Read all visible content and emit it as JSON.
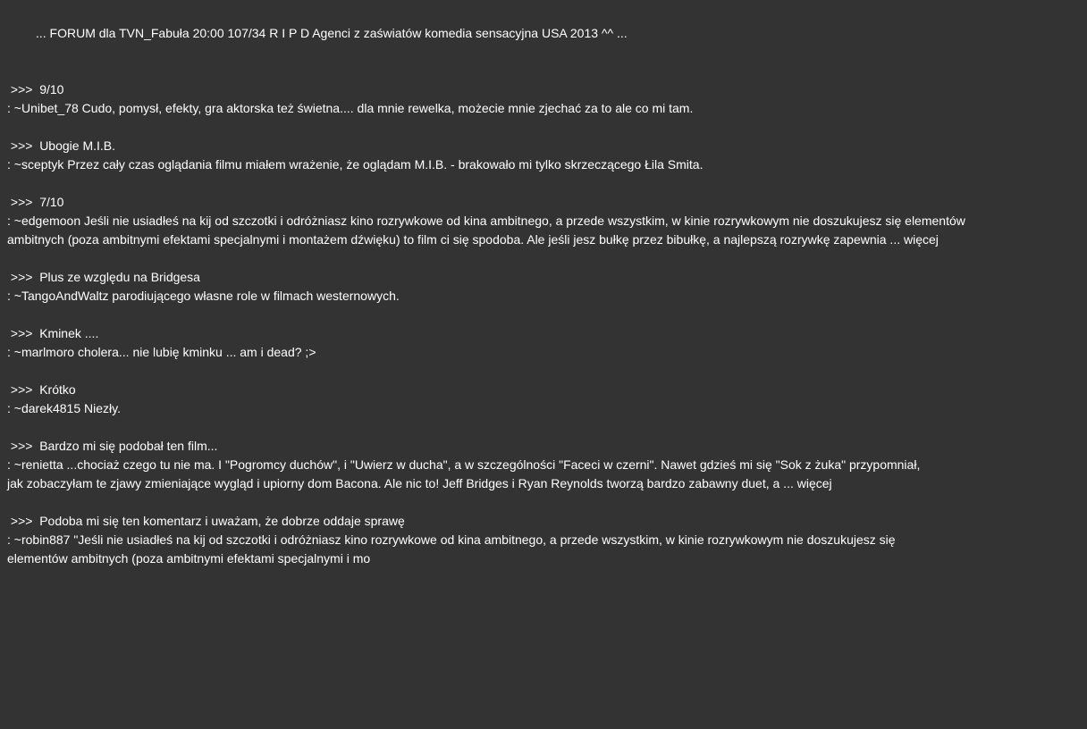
{
  "header": {
    "text": "... FORUM dla TVN_Fabuła 20:00 107/34 R I P D Agenci z zaświatów komedia sensacyjna USA 2013 ^^ ..."
  },
  "posts": [
    {
      "title": " >>>  9/10",
      "lines": [
        ": ~Unibet_78 Cudo, pomysł, efekty, gra aktorska też świetna.... dla mnie rewelka, możecie mnie zjechać za to ale co mi tam."
      ]
    },
    {
      "title": " >>>  Ubogie M.I.B.",
      "lines": [
        ": ~sceptyk Przez cały czas oglądania filmu miałem wrażenie, że oglądam M.I.B. - brakowało mi tylko skrzeczącego Łila Smita."
      ]
    },
    {
      "title": " >>>  7/10",
      "lines": [
        ": ~edgemoon Jeśli nie usiadłeś na kij od szczotki i odróżniasz kino rozrywkowe od kina ambitnego, a przede wszystkim, w kinie rozrywkowym nie doszukujesz się elementów",
        "ambitnych (poza ambitnymi efektami specjalnymi i montażem dźwięku) to film ci się spodoba. Ale jeśli jesz bułkę przez bibułkę, a najlepszą rozrywkę zapewnia ... więcej"
      ]
    },
    {
      "title": " >>>  Plus ze względu na Bridgesa",
      "lines": [
        ": ~TangoAndWaltz parodiującego własne role w filmach westernowych."
      ]
    },
    {
      "title": " >>>  Kminek ....",
      "lines": [
        ": ~marlmoro cholera... nie lubię kminku ... am i dead? ;>"
      ]
    },
    {
      "title": " >>>  Krótko",
      "lines": [
        ": ~darek4815 Niezły."
      ]
    },
    {
      "title": " >>>  Bardzo mi się podobał ten film...",
      "lines": [
        ": ~renietta ...chociaż czego tu nie ma. I \"Pogromcy duchów\", i \"Uwierz w ducha\", a w szczególności \"Faceci w czerni\". Nawet gdzieś mi się \"Sok z żuka\" przypomniał,",
        "jak zobaczyłam te zjawy zmieniające wygląd i upiorny dom Bacona. Ale nic to! Jeff Bridges i Ryan Reynolds tworzą bardzo zabawny duet, a ... więcej"
      ]
    },
    {
      "title": " >>>  Podoba mi się ten komentarz i uważam, że dobrze oddaje sprawę",
      "lines": [
        ": ~robin887 \"Jeśli nie usiadłeś na kij od szczotki i odróżniasz kino rozrywkowe od kina ambitnego, a przede wszystkim, w kinie rozrywkowym nie doszukujesz się",
        "elementów ambitnych (poza ambitnymi efektami specjalnymi i mo"
      ]
    }
  ]
}
